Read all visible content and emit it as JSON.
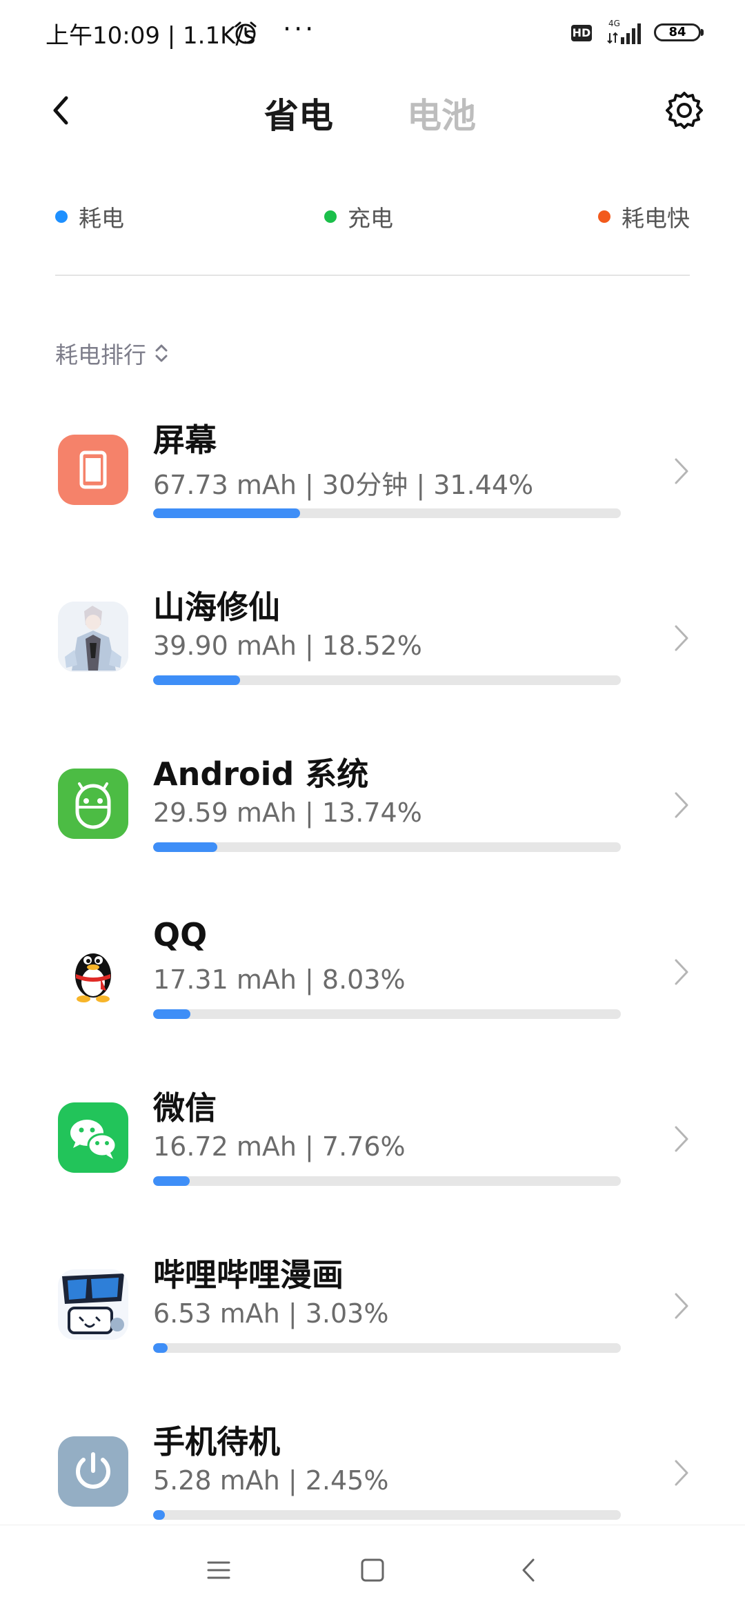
{
  "status_bar": {
    "time": "上午10:09 | 1.1K/s",
    "more": "···",
    "hd": "HD",
    "network": "4G",
    "battery": "84"
  },
  "header": {
    "tab_active": "省电",
    "tab_inactive": "电池"
  },
  "legend": [
    {
      "label": "耗电",
      "color": "#1e90ff"
    },
    {
      "label": "充电",
      "color": "#1bbf4a"
    },
    {
      "label": "耗电快",
      "color": "#f25a1c"
    }
  ],
  "sort_label": "耗电排行",
  "colors": {
    "accent": "#3e8ef7",
    "track": "#e6e6e6"
  },
  "apps": [
    {
      "name": "屏幕",
      "detail": "67.73 mAh | 30分钟 | 31.44%",
      "percent": 31.44,
      "icon": "screen-icon"
    },
    {
      "name": "山海修仙",
      "detail": "39.90 mAh | 18.52%",
      "percent": 18.52,
      "icon": "shanhai-game-icon"
    },
    {
      "name": "Android 系统",
      "detail": "29.59 mAh | 13.74%",
      "percent": 13.74,
      "icon": "android-icon"
    },
    {
      "name": "QQ",
      "detail": "17.31 mAh | 8.03%",
      "percent": 8.03,
      "icon": "qq-icon"
    },
    {
      "name": "微信",
      "detail": "16.72 mAh | 7.76%",
      "percent": 7.76,
      "icon": "wechat-icon"
    },
    {
      "name": "哔哩哔哩漫画",
      "detail": "6.53 mAh | 3.03%",
      "percent": 3.03,
      "icon": "bilibili-comics-icon"
    },
    {
      "name": "手机待机",
      "detail": "5.28 mAh | 2.45%",
      "percent": 2.45,
      "icon": "power-icon"
    }
  ]
}
